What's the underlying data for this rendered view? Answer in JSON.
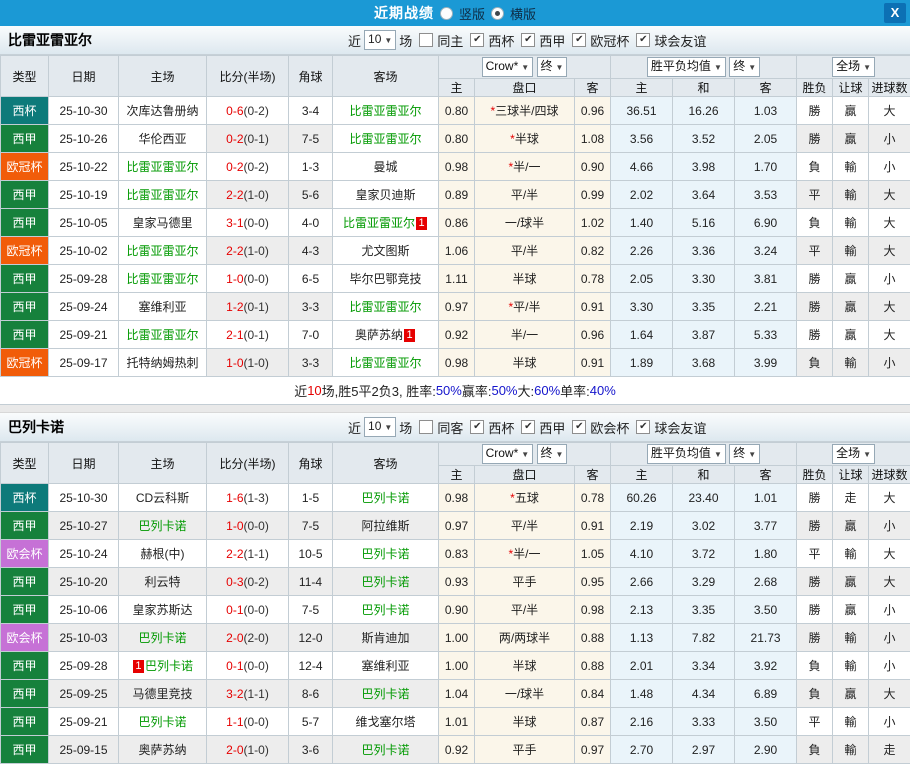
{
  "titlebar": {
    "title": "近期战绩",
    "vertical_label": "竖版",
    "horizontal_label": "横版",
    "selected_layout": "横版",
    "close_label": "X",
    "bar_color": "#1b99d5"
  },
  "filters": {
    "near_label": "近",
    "count": "10",
    "games_label": "场"
  },
  "selects": {
    "company": "Crow*",
    "company_state": "终",
    "avg": "胜平负均值",
    "avg_state": "终",
    "scope": "全场"
  },
  "columns": [
    "类型",
    "日期",
    "主场",
    "比分(半场)",
    "角球",
    "客场"
  ],
  "odds_subheaders": [
    "主",
    "盘口",
    "客",
    "主",
    "和",
    "客",
    "胜负",
    "让球",
    "进球数"
  ],
  "handicap_star": "*",
  "type_colors": {
    "西杯": "#0d7a7a",
    "西甲": "#16813c",
    "欧冠杯": "#f15c09",
    "欧会杯": "#c671d6"
  },
  "result_colors": {
    "r": "#d90000",
    "g": "#008000",
    "b": "#1414cc"
  },
  "sections": [
    {
      "team": "比雷亚雷亚尔",
      "same_label": "同主",
      "same_checked": false,
      "comps": [
        "西杯",
        "西甲",
        "欧冠杯",
        "球会友谊"
      ],
      "rows": [
        {
          "t": "西杯",
          "d": "25-10-30",
          "h": "次库达鲁册纳",
          "hg": false,
          "hb": "",
          "s": "0-6",
          "sh": "(0-2)",
          "ck": "3-4",
          "a": "比雷亚雷亚尔",
          "ag": true,
          "ab": "",
          "oh": "0.80",
          "st": true,
          "hc": "三球半/四球",
          "oa": "0.96",
          "mh": "36.51",
          "md": "16.26",
          "ma": "1.03",
          "r1": "勝",
          "c1": "r",
          "r2": "贏",
          "c2": "r",
          "r3": "大",
          "c3": "r"
        },
        {
          "t": "西甲",
          "d": "25-10-26",
          "h": "华伦西亚",
          "hg": false,
          "hb": "",
          "s": "0-2",
          "sh": "(0-1)",
          "ck": "7-5",
          "a": "比雷亚雷亚尔",
          "ag": true,
          "ab": "",
          "oh": "0.80",
          "st": true,
          "hc": "半球",
          "oa": "1.08",
          "mh": "3.56",
          "md": "3.52",
          "ma": "2.05",
          "r1": "勝",
          "c1": "r",
          "r2": "贏",
          "c2": "r",
          "r3": "小",
          "c3": "g"
        },
        {
          "t": "欧冠杯",
          "d": "25-10-22",
          "h": "比雷亚雷亚尔",
          "hg": true,
          "hb": "",
          "s": "0-2",
          "sh": "(0-2)",
          "ck": "1-3",
          "a": "曼城",
          "ag": false,
          "ab": "",
          "oh": "0.98",
          "st": true,
          "hc": "半/一",
          "oa": "0.90",
          "mh": "4.66",
          "md": "3.98",
          "ma": "1.70",
          "r1": "負",
          "c1": "g",
          "r2": "輸",
          "c2": "g",
          "r3": "小",
          "c3": "g"
        },
        {
          "t": "西甲",
          "d": "25-10-19",
          "h": "比雷亚雷亚尔",
          "hg": true,
          "hb": "",
          "s": "2-2",
          "sh": "(1-0)",
          "ck": "5-6",
          "a": "皇家贝迪斯",
          "ag": false,
          "ab": "",
          "oh": "0.89",
          "st": false,
          "hc": "平/半",
          "oa": "0.99",
          "mh": "2.02",
          "md": "3.64",
          "ma": "3.53",
          "r1": "平",
          "c1": "b",
          "r2": "輸",
          "c2": "g",
          "r3": "大",
          "c3": "r"
        },
        {
          "t": "西甲",
          "d": "25-10-05",
          "h": "皇家马德里",
          "hg": false,
          "hb": "",
          "s": "3-1",
          "sh": "(0-0)",
          "ck": "4-0",
          "a": "比雷亚雷亚尔",
          "ag": true,
          "ab": "1",
          "oh": "0.86",
          "st": false,
          "hc": "一/球半",
          "oa": "1.02",
          "mh": "1.40",
          "md": "5.16",
          "ma": "6.90",
          "r1": "負",
          "c1": "g",
          "r2": "輸",
          "c2": "g",
          "r3": "大",
          "c3": "r"
        },
        {
          "t": "欧冠杯",
          "d": "25-10-02",
          "h": "比雷亚雷亚尔",
          "hg": true,
          "hb": "",
          "s": "2-2",
          "sh": "(1-0)",
          "ck": "4-3",
          "a": "尤文图斯",
          "ag": false,
          "ab": "",
          "oh": "1.06",
          "st": false,
          "hc": "平/半",
          "oa": "0.82",
          "mh": "2.26",
          "md": "3.36",
          "ma": "3.24",
          "r1": "平",
          "c1": "b",
          "r2": "輸",
          "c2": "g",
          "r3": "大",
          "c3": "r"
        },
        {
          "t": "西甲",
          "d": "25-09-28",
          "h": "比雷亚雷亚尔",
          "hg": true,
          "hb": "",
          "s": "1-0",
          "sh": "(0-0)",
          "ck": "6-5",
          "a": "毕尔巴鄂竞技",
          "ag": false,
          "ab": "",
          "oh": "1.11",
          "st": false,
          "hc": "半球",
          "oa": "0.78",
          "mh": "2.05",
          "md": "3.30",
          "ma": "3.81",
          "r1": "勝",
          "c1": "r",
          "r2": "贏",
          "c2": "r",
          "r3": "小",
          "c3": "g"
        },
        {
          "t": "西甲",
          "d": "25-09-24",
          "h": "塞维利亚",
          "hg": false,
          "hb": "",
          "s": "1-2",
          "sh": "(0-1)",
          "ck": "3-3",
          "a": "比雷亚雷亚尔",
          "ag": true,
          "ab": "",
          "oh": "0.97",
          "st": true,
          "hc": "平/半",
          "oa": "0.91",
          "mh": "3.30",
          "md": "3.35",
          "ma": "2.21",
          "r1": "勝",
          "c1": "r",
          "r2": "贏",
          "c2": "r",
          "r3": "大",
          "c3": "r"
        },
        {
          "t": "西甲",
          "d": "25-09-21",
          "h": "比雷亚雷亚尔",
          "hg": true,
          "hb": "",
          "s": "2-1",
          "sh": "(0-1)",
          "ck": "7-0",
          "a": "奥萨苏纳",
          "ag": false,
          "ab": "1",
          "oh": "0.92",
          "st": false,
          "hc": "半/一",
          "oa": "0.96",
          "mh": "1.64",
          "md": "3.87",
          "ma": "5.33",
          "r1": "勝",
          "c1": "r",
          "r2": "贏",
          "c2": "r",
          "r3": "大",
          "c3": "r"
        },
        {
          "t": "欧冠杯",
          "d": "25-09-17",
          "h": "托特纳姆热刺",
          "hg": false,
          "hb": "",
          "s": "1-0",
          "sh": "(1-0)",
          "ck": "3-3",
          "a": "比雷亚雷亚尔",
          "ag": true,
          "ab": "",
          "oh": "0.98",
          "st": false,
          "hc": "半球",
          "oa": "0.91",
          "mh": "1.89",
          "md": "3.68",
          "ma": "3.99",
          "r1": "負",
          "c1": "g",
          "r2": "輸",
          "c2": "g",
          "r3": "小",
          "c3": "g"
        }
      ],
      "summary": [
        [
          "近",
          "k"
        ],
        [
          "10",
          "r"
        ],
        [
          "场,胜5平2负3, 胜率:",
          "k"
        ],
        [
          "50%",
          "b"
        ],
        [
          " 赢率:",
          "k"
        ],
        [
          "50%",
          "b"
        ],
        [
          " 大:",
          "k"
        ],
        [
          "60%",
          "b"
        ],
        [
          " 单率:",
          "k"
        ],
        [
          "40%",
          "b"
        ]
      ]
    },
    {
      "team": "巴列卡诺",
      "same_label": "同客",
      "same_checked": false,
      "comps": [
        "西杯",
        "西甲",
        "欧会杯",
        "球会友谊"
      ],
      "rows": [
        {
          "t": "西杯",
          "d": "25-10-30",
          "h": "CD云科斯",
          "hg": false,
          "hb": "",
          "s": "1-6",
          "sh": "(1-3)",
          "ck": "1-5",
          "a": "巴列卡诺",
          "ag": true,
          "ab": "",
          "oh": "0.98",
          "st": true,
          "hc": "五球",
          "oa": "0.78",
          "mh": "60.26",
          "md": "23.40",
          "ma": "1.01",
          "r1": "勝",
          "c1": "r",
          "r2": "走",
          "c2": "b",
          "r3": "大",
          "c3": "r"
        },
        {
          "t": "西甲",
          "d": "25-10-27",
          "h": "巴列卡诺",
          "hg": true,
          "hb": "",
          "s": "1-0",
          "sh": "(0-0)",
          "ck": "7-5",
          "a": "阿拉维斯",
          "ag": false,
          "ab": "",
          "oh": "0.97",
          "st": false,
          "hc": "平/半",
          "oa": "0.91",
          "mh": "2.19",
          "md": "3.02",
          "ma": "3.77",
          "r1": "勝",
          "c1": "r",
          "r2": "贏",
          "c2": "r",
          "r3": "小",
          "c3": "g"
        },
        {
          "t": "欧会杯",
          "d": "25-10-24",
          "h": "赫根(中)",
          "hg": false,
          "hb": "",
          "s": "2-2",
          "sh": "(1-1)",
          "ck": "10-5",
          "a": "巴列卡诺",
          "ag": true,
          "ab": "",
          "oh": "0.83",
          "st": true,
          "hc": "半/一",
          "oa": "1.05",
          "mh": "4.10",
          "md": "3.72",
          "ma": "1.80",
          "r1": "平",
          "c1": "b",
          "r2": "輸",
          "c2": "g",
          "r3": "大",
          "c3": "r"
        },
        {
          "t": "西甲",
          "d": "25-10-20",
          "h": "利云特",
          "hg": false,
          "hb": "",
          "s": "0-3",
          "sh": "(0-2)",
          "ck": "11-4",
          "a": "巴列卡诺",
          "ag": true,
          "ab": "",
          "oh": "0.93",
          "st": false,
          "hc": "平手",
          "oa": "0.95",
          "mh": "2.66",
          "md": "3.29",
          "ma": "2.68",
          "r1": "勝",
          "c1": "r",
          "r2": "贏",
          "c2": "r",
          "r3": "大",
          "c3": "r"
        },
        {
          "t": "西甲",
          "d": "25-10-06",
          "h": "皇家苏斯达",
          "hg": false,
          "hb": "",
          "s": "0-1",
          "sh": "(0-0)",
          "ck": "7-5",
          "a": "巴列卡诺",
          "ag": true,
          "ab": "",
          "oh": "0.90",
          "st": false,
          "hc": "平/半",
          "oa": "0.98",
          "mh": "2.13",
          "md": "3.35",
          "ma": "3.50",
          "r1": "勝",
          "c1": "r",
          "r2": "贏",
          "c2": "r",
          "r3": "小",
          "c3": "g"
        },
        {
          "t": "欧会杯",
          "d": "25-10-03",
          "h": "巴列卡诺",
          "hg": true,
          "hb": "",
          "s": "2-0",
          "sh": "(2-0)",
          "ck": "12-0",
          "a": "斯肯迪加",
          "ag": false,
          "ab": "",
          "oh": "1.00",
          "st": false,
          "hc": "两/两球半",
          "oa": "0.88",
          "mh": "1.13",
          "md": "7.82",
          "ma": "21.73",
          "r1": "勝",
          "c1": "r",
          "r2": "輸",
          "c2": "g",
          "r3": "小",
          "c3": "g"
        },
        {
          "t": "西甲",
          "d": "25-09-28",
          "h": "巴列卡诺",
          "hg": true,
          "hb": "1",
          "s": "0-1",
          "sh": "(0-0)",
          "ck": "12-4",
          "a": "塞维利亚",
          "ag": false,
          "ab": "",
          "oh": "1.00",
          "st": false,
          "hc": "半球",
          "oa": "0.88",
          "mh": "2.01",
          "md": "3.34",
          "ma": "3.92",
          "r1": "負",
          "c1": "g",
          "r2": "輸",
          "c2": "g",
          "r3": "小",
          "c3": "g"
        },
        {
          "t": "西甲",
          "d": "25-09-25",
          "h": "马德里竞技",
          "hg": false,
          "hb": "",
          "s": "3-2",
          "sh": "(1-1)",
          "ck": "8-6",
          "a": "巴列卡诺",
          "ag": true,
          "ab": "",
          "oh": "1.04",
          "st": false,
          "hc": "一/球半",
          "oa": "0.84",
          "mh": "1.48",
          "md": "4.34",
          "ma": "6.89",
          "r1": "負",
          "c1": "g",
          "r2": "贏",
          "c2": "r",
          "r3": "大",
          "c3": "r"
        },
        {
          "t": "西甲",
          "d": "25-09-21",
          "h": "巴列卡诺",
          "hg": true,
          "hb": "",
          "s": "1-1",
          "sh": "(0-0)",
          "ck": "5-7",
          "a": "维戈塞尔塔",
          "ag": false,
          "ab": "",
          "oh": "1.01",
          "st": false,
          "hc": "半球",
          "oa": "0.87",
          "mh": "2.16",
          "md": "3.33",
          "ma": "3.50",
          "r1": "平",
          "c1": "b",
          "r2": "輸",
          "c2": "g",
          "r3": "小",
          "c3": "g"
        },
        {
          "t": "西甲",
          "d": "25-09-15",
          "h": "奥萨苏纳",
          "hg": false,
          "hb": "",
          "s": "2-0",
          "sh": "(1-0)",
          "ck": "3-6",
          "a": "巴列卡诺",
          "ag": true,
          "ab": "",
          "oh": "0.92",
          "st": false,
          "hc": "平手",
          "oa": "0.97",
          "mh": "2.70",
          "md": "2.97",
          "ma": "2.90",
          "r1": "負",
          "c1": "g",
          "r2": "輸",
          "c2": "g",
          "r3": "走",
          "c3": "b"
        }
      ],
      "summary": null
    }
  ]
}
